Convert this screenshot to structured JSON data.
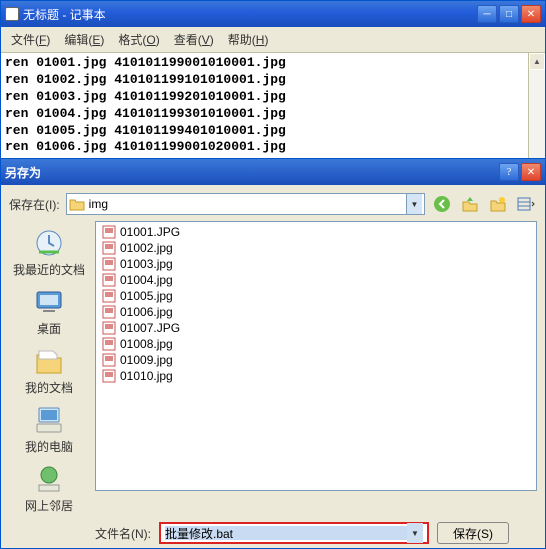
{
  "notepad": {
    "title": "无标题 - 记事本",
    "menus": [
      {
        "label": "文件",
        "key": "F"
      },
      {
        "label": "编辑",
        "key": "E"
      },
      {
        "label": "格式",
        "key": "O"
      },
      {
        "label": "查看",
        "key": "V"
      },
      {
        "label": "帮助",
        "key": "H"
      }
    ],
    "content": "ren 01001.jpg 410101199001010001.jpg\nren 01002.jpg 410101199101010001.jpg\nren 01003.jpg 410101199201010001.jpg\nren 01004.jpg 410101199301010001.jpg\nren 01005.jpg 410101199401010001.jpg\nren 01006.jpg 410101199001020001.jpg"
  },
  "saveas": {
    "title": "另存为",
    "save_in_label": "保存在(I):",
    "location": "img",
    "sidebar": [
      {
        "label": "我最近的文档",
        "icon": "recent"
      },
      {
        "label": "桌面",
        "icon": "desktop"
      },
      {
        "label": "我的文档",
        "icon": "mydocs"
      },
      {
        "label": "我的电脑",
        "icon": "mycomputer"
      },
      {
        "label": "网上邻居",
        "icon": "network"
      }
    ],
    "files": [
      "01001.JPG",
      "01002.jpg",
      "01003.jpg",
      "01004.jpg",
      "01005.jpg",
      "01006.jpg",
      "01007.JPG",
      "01008.jpg",
      "01009.jpg",
      "01010.jpg"
    ],
    "filename_label": "文件名(N):",
    "filename_value": "批量修改.bat",
    "save_btn": "保存(S)"
  }
}
